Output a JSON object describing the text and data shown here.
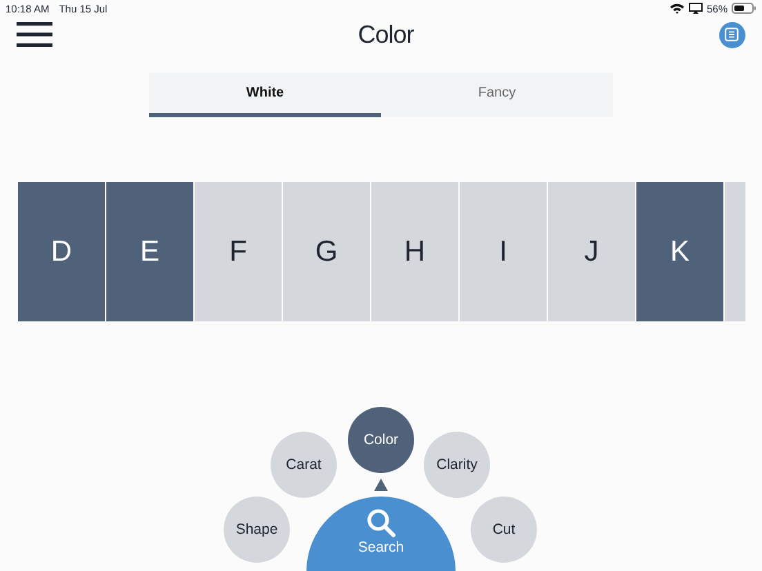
{
  "status_bar": {
    "time": "10:18 AM",
    "date": "Thu 15 Jul",
    "battery": "56%"
  },
  "header": {
    "title": "Color"
  },
  "tabs": [
    {
      "label": "White",
      "selected": true
    },
    {
      "label": "Fancy",
      "selected": false
    }
  ],
  "grades": [
    {
      "label": "D",
      "selected": true
    },
    {
      "label": "E",
      "selected": true
    },
    {
      "label": "F",
      "selected": false
    },
    {
      "label": "G",
      "selected": false
    },
    {
      "label": "H",
      "selected": false
    },
    {
      "label": "I",
      "selected": false
    },
    {
      "label": "J",
      "selected": false
    },
    {
      "label": "K",
      "selected": true
    }
  ],
  "menu": {
    "items": [
      {
        "label": "Shape",
        "selected": false
      },
      {
        "label": "Carat",
        "selected": false
      },
      {
        "label": "Color",
        "selected": true
      },
      {
        "label": "Clarity",
        "selected": false
      },
      {
        "label": "Cut",
        "selected": false
      }
    ],
    "search": "Search"
  }
}
